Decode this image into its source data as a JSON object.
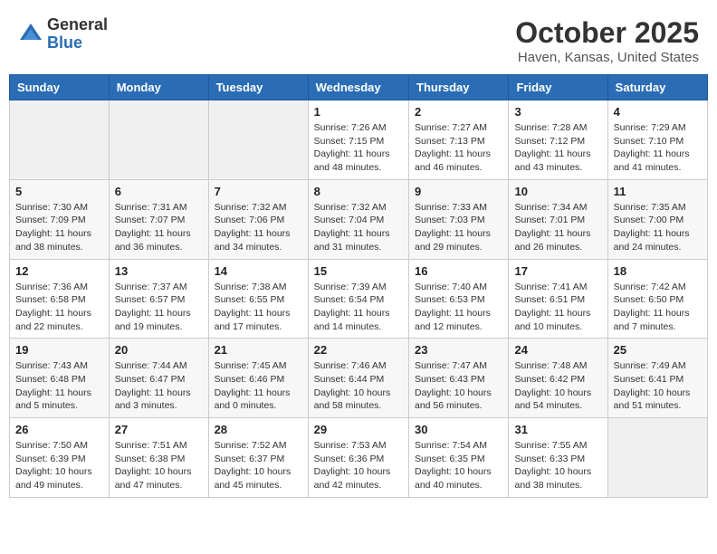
{
  "logo": {
    "general": "General",
    "blue": "Blue"
  },
  "header": {
    "month": "October 2025",
    "location": "Haven, Kansas, United States"
  },
  "weekdays": [
    "Sunday",
    "Monday",
    "Tuesday",
    "Wednesday",
    "Thursday",
    "Friday",
    "Saturday"
  ],
  "weeks": [
    [
      {
        "day": "",
        "sunrise": "",
        "sunset": "",
        "daylight": ""
      },
      {
        "day": "",
        "sunrise": "",
        "sunset": "",
        "daylight": ""
      },
      {
        "day": "",
        "sunrise": "",
        "sunset": "",
        "daylight": ""
      },
      {
        "day": "1",
        "sunrise": "Sunrise: 7:26 AM",
        "sunset": "Sunset: 7:15 PM",
        "daylight": "Daylight: 11 hours and 48 minutes."
      },
      {
        "day": "2",
        "sunrise": "Sunrise: 7:27 AM",
        "sunset": "Sunset: 7:13 PM",
        "daylight": "Daylight: 11 hours and 46 minutes."
      },
      {
        "day": "3",
        "sunrise": "Sunrise: 7:28 AM",
        "sunset": "Sunset: 7:12 PM",
        "daylight": "Daylight: 11 hours and 43 minutes."
      },
      {
        "day": "4",
        "sunrise": "Sunrise: 7:29 AM",
        "sunset": "Sunset: 7:10 PM",
        "daylight": "Daylight: 11 hours and 41 minutes."
      }
    ],
    [
      {
        "day": "5",
        "sunrise": "Sunrise: 7:30 AM",
        "sunset": "Sunset: 7:09 PM",
        "daylight": "Daylight: 11 hours and 38 minutes."
      },
      {
        "day": "6",
        "sunrise": "Sunrise: 7:31 AM",
        "sunset": "Sunset: 7:07 PM",
        "daylight": "Daylight: 11 hours and 36 minutes."
      },
      {
        "day": "7",
        "sunrise": "Sunrise: 7:32 AM",
        "sunset": "Sunset: 7:06 PM",
        "daylight": "Daylight: 11 hours and 34 minutes."
      },
      {
        "day": "8",
        "sunrise": "Sunrise: 7:32 AM",
        "sunset": "Sunset: 7:04 PM",
        "daylight": "Daylight: 11 hours and 31 minutes."
      },
      {
        "day": "9",
        "sunrise": "Sunrise: 7:33 AM",
        "sunset": "Sunset: 7:03 PM",
        "daylight": "Daylight: 11 hours and 29 minutes."
      },
      {
        "day": "10",
        "sunrise": "Sunrise: 7:34 AM",
        "sunset": "Sunset: 7:01 PM",
        "daylight": "Daylight: 11 hours and 26 minutes."
      },
      {
        "day": "11",
        "sunrise": "Sunrise: 7:35 AM",
        "sunset": "Sunset: 7:00 PM",
        "daylight": "Daylight: 11 hours and 24 minutes."
      }
    ],
    [
      {
        "day": "12",
        "sunrise": "Sunrise: 7:36 AM",
        "sunset": "Sunset: 6:58 PM",
        "daylight": "Daylight: 11 hours and 22 minutes."
      },
      {
        "day": "13",
        "sunrise": "Sunrise: 7:37 AM",
        "sunset": "Sunset: 6:57 PM",
        "daylight": "Daylight: 11 hours and 19 minutes."
      },
      {
        "day": "14",
        "sunrise": "Sunrise: 7:38 AM",
        "sunset": "Sunset: 6:55 PM",
        "daylight": "Daylight: 11 hours and 17 minutes."
      },
      {
        "day": "15",
        "sunrise": "Sunrise: 7:39 AM",
        "sunset": "Sunset: 6:54 PM",
        "daylight": "Daylight: 11 hours and 14 minutes."
      },
      {
        "day": "16",
        "sunrise": "Sunrise: 7:40 AM",
        "sunset": "Sunset: 6:53 PM",
        "daylight": "Daylight: 11 hours and 12 minutes."
      },
      {
        "day": "17",
        "sunrise": "Sunrise: 7:41 AM",
        "sunset": "Sunset: 6:51 PM",
        "daylight": "Daylight: 11 hours and 10 minutes."
      },
      {
        "day": "18",
        "sunrise": "Sunrise: 7:42 AM",
        "sunset": "Sunset: 6:50 PM",
        "daylight": "Daylight: 11 hours and 7 minutes."
      }
    ],
    [
      {
        "day": "19",
        "sunrise": "Sunrise: 7:43 AM",
        "sunset": "Sunset: 6:48 PM",
        "daylight": "Daylight: 11 hours and 5 minutes."
      },
      {
        "day": "20",
        "sunrise": "Sunrise: 7:44 AM",
        "sunset": "Sunset: 6:47 PM",
        "daylight": "Daylight: 11 hours and 3 minutes."
      },
      {
        "day": "21",
        "sunrise": "Sunrise: 7:45 AM",
        "sunset": "Sunset: 6:46 PM",
        "daylight": "Daylight: 11 hours and 0 minutes."
      },
      {
        "day": "22",
        "sunrise": "Sunrise: 7:46 AM",
        "sunset": "Sunset: 6:44 PM",
        "daylight": "Daylight: 10 hours and 58 minutes."
      },
      {
        "day": "23",
        "sunrise": "Sunrise: 7:47 AM",
        "sunset": "Sunset: 6:43 PM",
        "daylight": "Daylight: 10 hours and 56 minutes."
      },
      {
        "day": "24",
        "sunrise": "Sunrise: 7:48 AM",
        "sunset": "Sunset: 6:42 PM",
        "daylight": "Daylight: 10 hours and 54 minutes."
      },
      {
        "day": "25",
        "sunrise": "Sunrise: 7:49 AM",
        "sunset": "Sunset: 6:41 PM",
        "daylight": "Daylight: 10 hours and 51 minutes."
      }
    ],
    [
      {
        "day": "26",
        "sunrise": "Sunrise: 7:50 AM",
        "sunset": "Sunset: 6:39 PM",
        "daylight": "Daylight: 10 hours and 49 minutes."
      },
      {
        "day": "27",
        "sunrise": "Sunrise: 7:51 AM",
        "sunset": "Sunset: 6:38 PM",
        "daylight": "Daylight: 10 hours and 47 minutes."
      },
      {
        "day": "28",
        "sunrise": "Sunrise: 7:52 AM",
        "sunset": "Sunset: 6:37 PM",
        "daylight": "Daylight: 10 hours and 45 minutes."
      },
      {
        "day": "29",
        "sunrise": "Sunrise: 7:53 AM",
        "sunset": "Sunset: 6:36 PM",
        "daylight": "Daylight: 10 hours and 42 minutes."
      },
      {
        "day": "30",
        "sunrise": "Sunrise: 7:54 AM",
        "sunset": "Sunset: 6:35 PM",
        "daylight": "Daylight: 10 hours and 40 minutes."
      },
      {
        "day": "31",
        "sunrise": "Sunrise: 7:55 AM",
        "sunset": "Sunset: 6:33 PM",
        "daylight": "Daylight: 10 hours and 38 minutes."
      },
      {
        "day": "",
        "sunrise": "",
        "sunset": "",
        "daylight": ""
      }
    ]
  ]
}
